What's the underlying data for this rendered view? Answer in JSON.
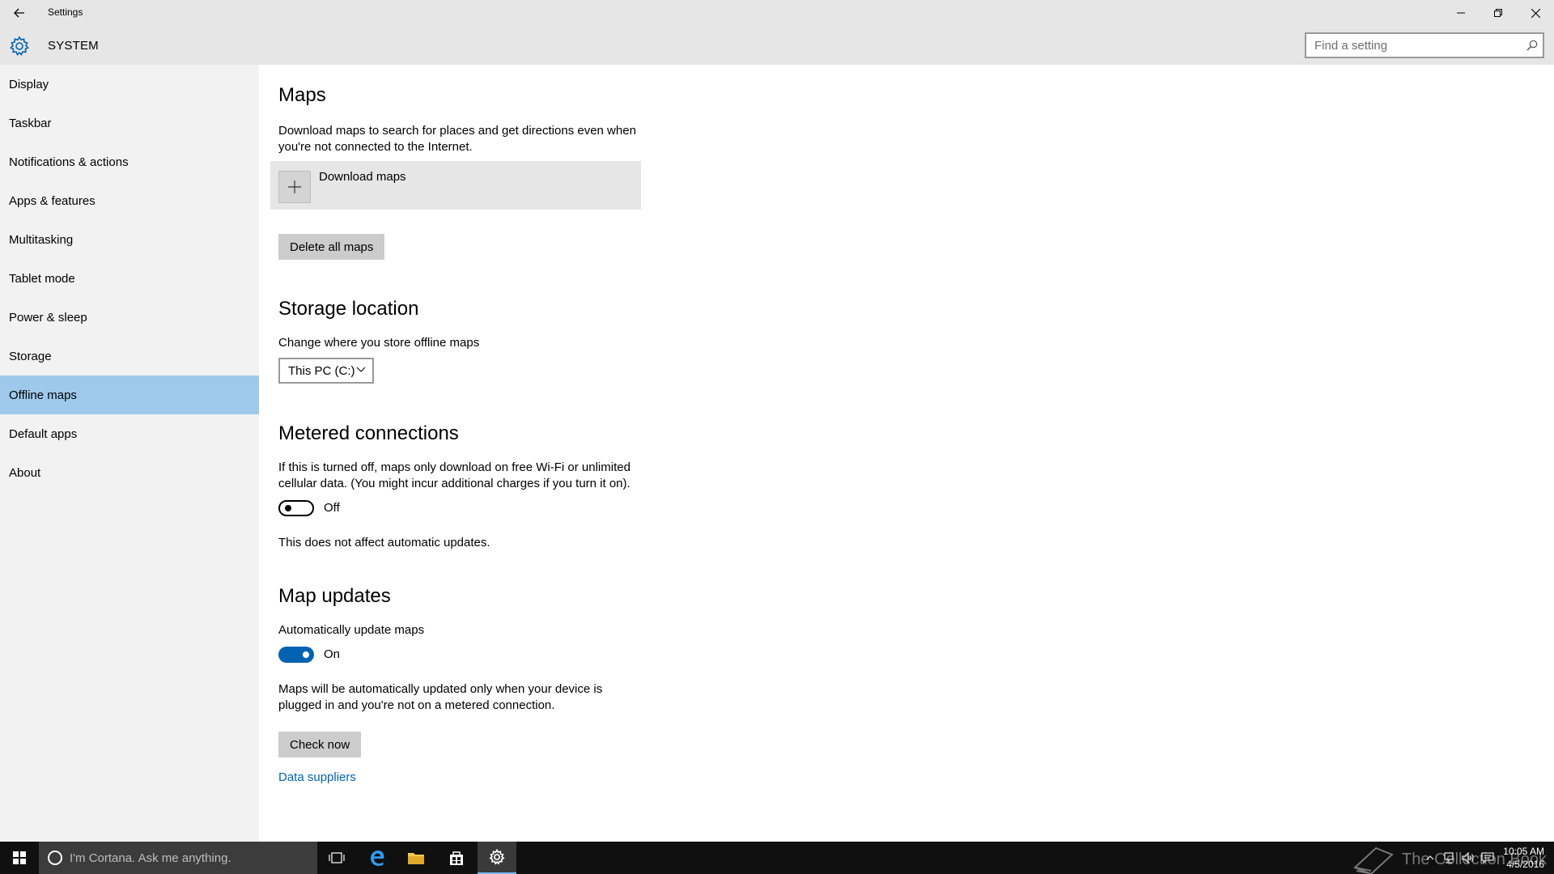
{
  "window": {
    "title": "Settings"
  },
  "header": {
    "section": "SYSTEM",
    "search_placeholder": "Find a setting"
  },
  "sidebar": {
    "items": [
      {
        "label": "Display"
      },
      {
        "label": "Taskbar"
      },
      {
        "label": "Notifications & actions"
      },
      {
        "label": "Apps & features"
      },
      {
        "label": "Multitasking"
      },
      {
        "label": "Tablet mode"
      },
      {
        "label": "Power & sleep"
      },
      {
        "label": "Storage"
      },
      {
        "label": "Offline maps",
        "selected": true
      },
      {
        "label": "Default apps"
      },
      {
        "label": "About"
      }
    ]
  },
  "maps": {
    "title": "Maps",
    "description_line1": "Download maps to search for places and get directions even when",
    "description_line2": "you're not connected to the Internet.",
    "download_label": "Download maps",
    "delete_label": "Delete all maps"
  },
  "storage": {
    "title": "Storage location",
    "description": "Change where you store offline maps",
    "selected_drive": "This PC (C:)"
  },
  "metered": {
    "title": "Metered connections",
    "description_line1": "If this is turned off, maps only download on free Wi-Fi or unlimited",
    "description_line2": "cellular data. (You might incur additional charges if you turn it on).",
    "toggle_state": "Off",
    "note": "This does not affect automatic updates."
  },
  "updates": {
    "title": "Map updates",
    "description": "Automatically update maps",
    "toggle_state": "On",
    "note_line1": "Maps will be automatically updated only when your device is",
    "note_line2": "plugged in and you're not on a metered connection.",
    "check_label": "Check now",
    "link_label": "Data suppliers"
  },
  "taskbar": {
    "cortana_placeholder": "I'm Cortana. Ask me anything.",
    "time": "10:05 AM",
    "date": "4/5/2016",
    "watermark": "The Collection Book"
  },
  "colors": {
    "accent": "#0063b1",
    "selected": "#9fc9ec",
    "chrome": "#e6e6e6",
    "sidebar": "#f2f2f2"
  }
}
